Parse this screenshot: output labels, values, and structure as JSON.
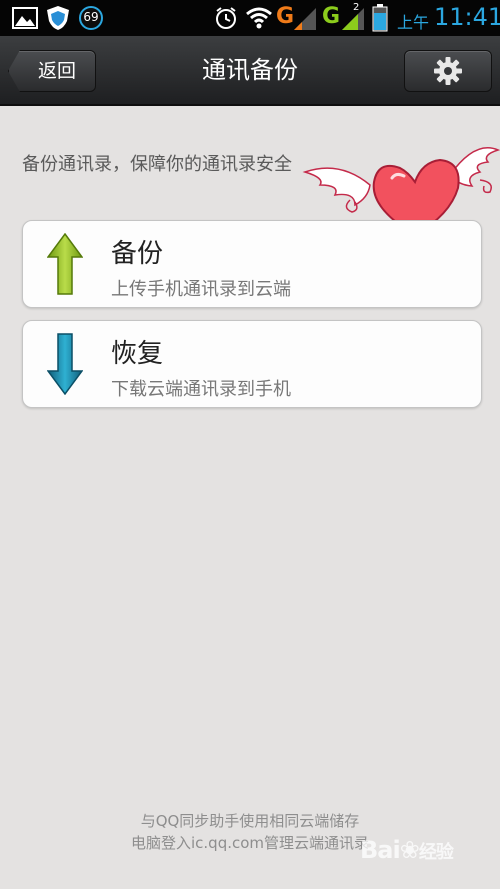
{
  "status_bar": {
    "notification_count": "69",
    "network_g1": "G",
    "network_g2": "G",
    "sim2_index": "2",
    "time_period": "上午",
    "time": "11:41"
  },
  "header": {
    "back_label": "返回",
    "title": "通讯备份"
  },
  "main": {
    "subtitle": "备份通讯录，保障你的通讯录安全",
    "options": [
      {
        "title": "备份",
        "description": "上传手机通讯录到云端",
        "icon": "arrow-up-icon",
        "color": "#8ab51e"
      },
      {
        "title": "恢复",
        "description": "下载云端通讯录到手机",
        "icon": "arrow-down-icon",
        "color": "#1b86a8"
      }
    ]
  },
  "footer": {
    "line1": "与QQ同步助手使用相同云端储存",
    "line2": "电脑登入ic.qq.com管理云端通讯录"
  },
  "watermark": {
    "text": "Bai",
    "text2": "经验"
  },
  "colors": {
    "accent_blue": "#2ba7e0",
    "network_orange": "#f07b19",
    "network_green": "#8ccc1c",
    "background": "#e4e2e1"
  }
}
